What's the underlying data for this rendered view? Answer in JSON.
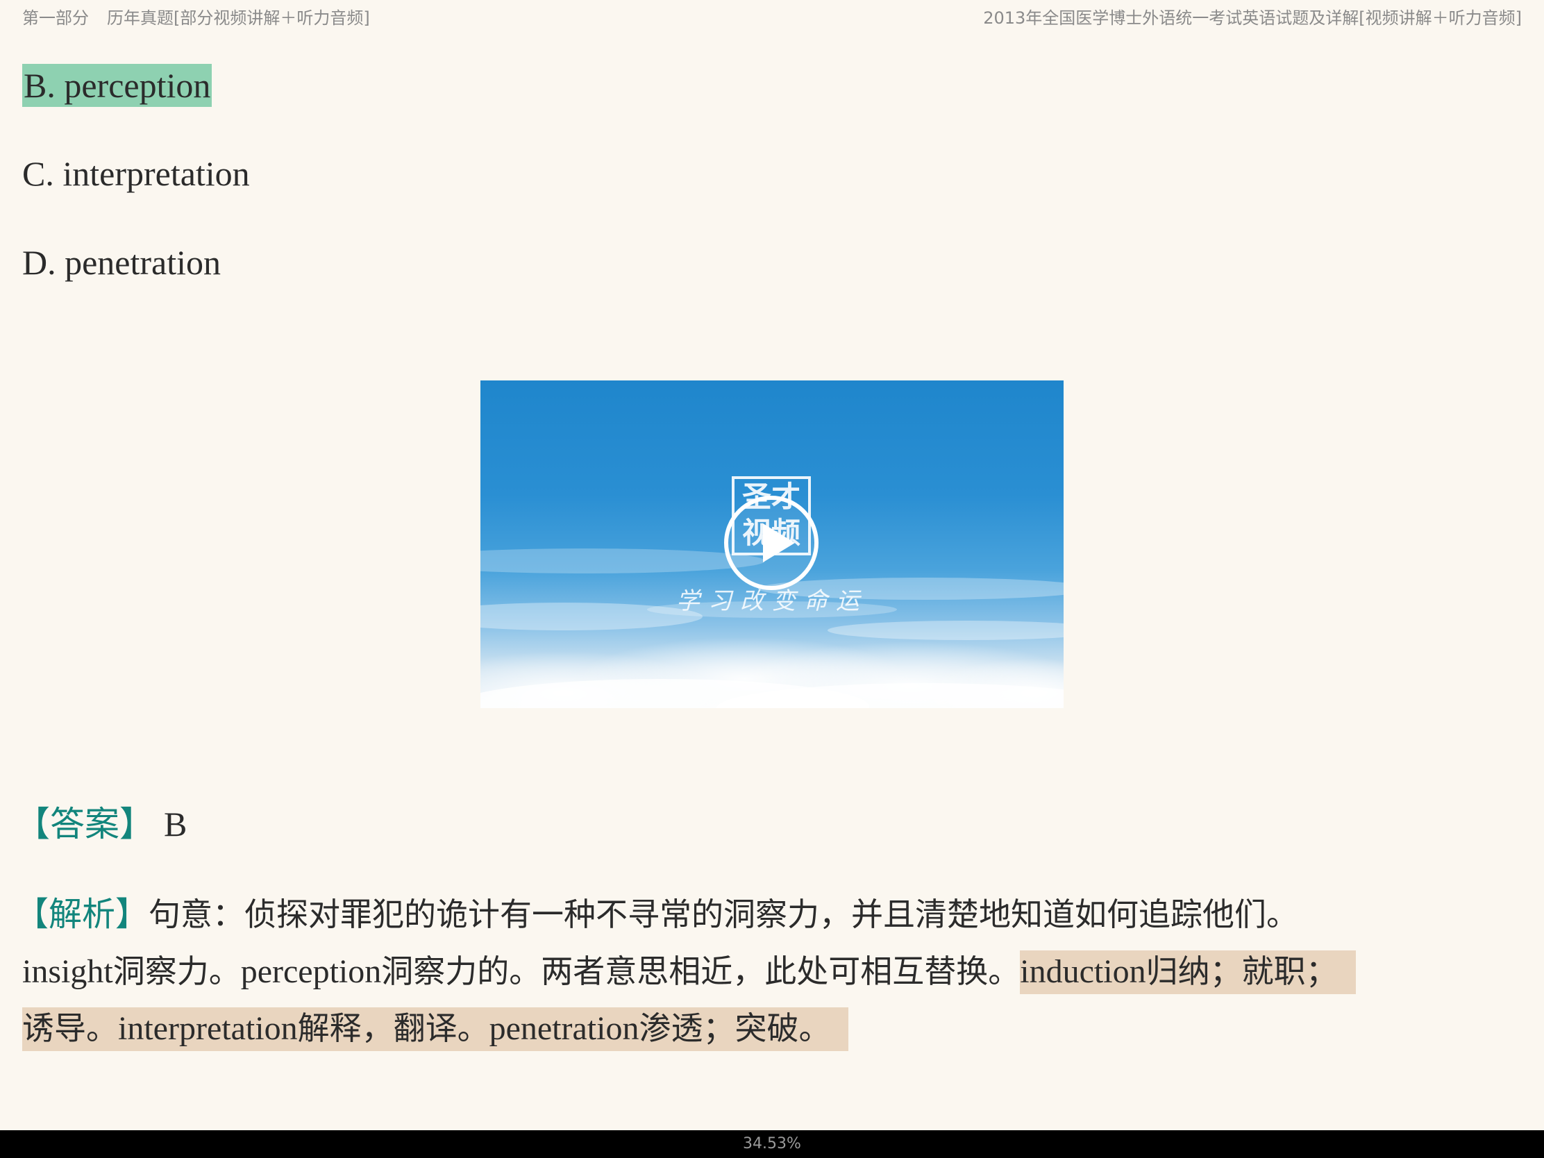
{
  "header": {
    "part": "第一部分",
    "section": "历年真题[部分视频讲解＋听力音频]",
    "book_title": "2013年全国医学博士外语统一考试英语试题及详解[视频讲解＋听力音频]"
  },
  "options": [
    {
      "label": "B. perception",
      "highlighted": true,
      "highlight_color": "#8ed1b1"
    },
    {
      "label": "C. interpretation",
      "highlighted": false
    },
    {
      "label": "D. penetration",
      "highlighted": false
    }
  ],
  "video": {
    "logo_line1": "圣才",
    "logo_line2": "视频",
    "slogan": "学习改变命运",
    "play_icon": "play-icon"
  },
  "answer": {
    "label": "【答案】",
    "value": "B"
  },
  "analysis": {
    "label": "【解析】",
    "line1": "句意：侦探对罪犯的诡计有一种不寻常的洞察力，并且清楚地知道如何追踪他们。",
    "line2_plain_en1": "insight",
    "line2_plain_zh1": "洞察力。",
    "line2_plain_en2": "perception",
    "line2_plain_zh2": "洞察力的。两者意思相近，此处可相互替换。",
    "line2_hl_en": "induction",
    "line2_hl_zh": "归纳；就职；",
    "line3_zh1": "诱导。",
    "line3_en1": "interpretation",
    "line3_zh2": "解释，翻译。",
    "line3_en2": "penetration",
    "line3_zh3": "渗透；突破。",
    "highlight_color": "#e9d5bf"
  },
  "progress": {
    "text": "34.53%",
    "value": 34.53
  },
  "colors": {
    "background": "#FBF7F0",
    "label_teal": "#12857c"
  }
}
